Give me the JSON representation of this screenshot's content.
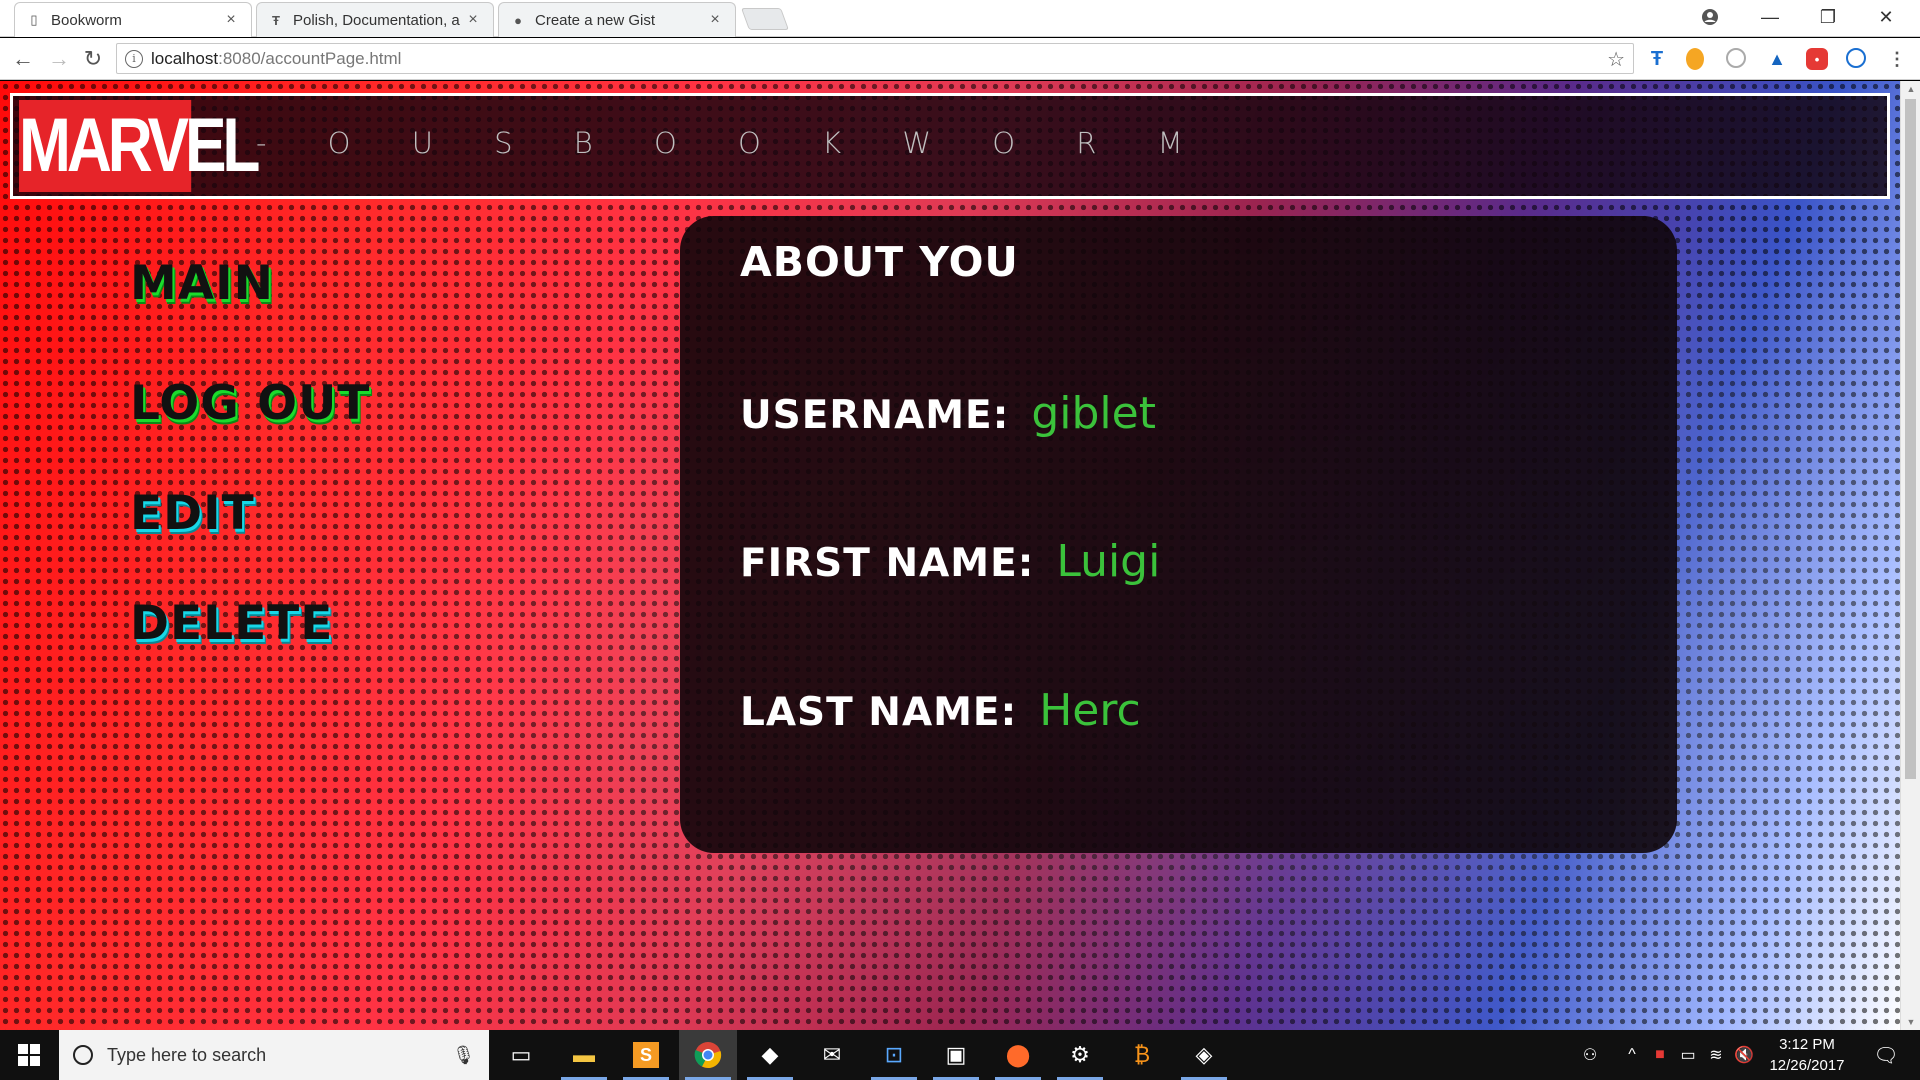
{
  "browser": {
    "tabs": [
      {
        "title": "Bookworm",
        "favicon": "page-icon",
        "active": true
      },
      {
        "title": "Polish, Documentation, a",
        "favicon": "typora-icon",
        "active": false
      },
      {
        "title": "Create a new Gist",
        "favicon": "github-icon",
        "active": false
      }
    ],
    "close_glyph": "×",
    "url_host": "localhost",
    "url_path": ":8080/accountPage.html",
    "info_glyph": "i",
    "star_glyph": "☆"
  },
  "page": {
    "logo_text": "MARVEL",
    "brand_rest": "- O U S   B O O K W O R M",
    "nav": {
      "main": "Main",
      "logout": "Log Out",
      "edit": "Edit",
      "delete": "Delete"
    },
    "about": {
      "title": "About You",
      "fields": [
        {
          "label": "Username:",
          "value": "giblet"
        },
        {
          "label": "First Name:",
          "value": "Luigi"
        },
        {
          "label": "Last Name:",
          "value": "Herc"
        }
      ]
    }
  },
  "taskbar": {
    "search_placeholder": "Type here to search",
    "time": "3:12 PM",
    "date": "12/26/2017"
  },
  "colors": {
    "accent_green": "#3bc23b",
    "marvel_red": "#e62429",
    "shadow_green": "#1bdc2c",
    "shadow_cyan": "#17d8e8"
  }
}
